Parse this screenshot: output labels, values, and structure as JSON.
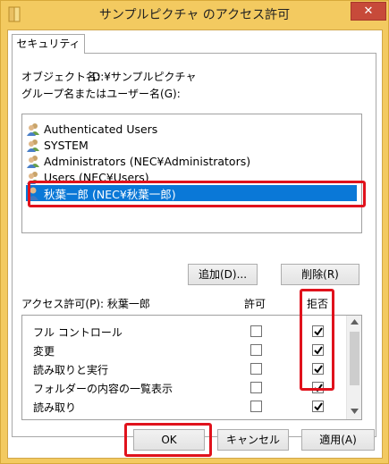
{
  "window": {
    "title": "サンプルピクチャ のアクセス許可",
    "close_glyph": "✕"
  },
  "tabs": [
    {
      "label": "セキュリティ"
    }
  ],
  "object": {
    "label": "オブジェクト名:",
    "value": "D:¥サンプルピクチャ"
  },
  "groups": {
    "label": "グループ名またはユーザー名(G):",
    "items": [
      {
        "name": "Authenticated Users",
        "icon": "users-group-icon"
      },
      {
        "name": "SYSTEM",
        "icon": "users-group-icon"
      },
      {
        "name": "Administrators (NEC¥Administrators)",
        "icon": "users-group-icon"
      },
      {
        "name": "Users (NEC¥Users)",
        "icon": "users-group-icon"
      },
      {
        "name": "秋葉一郎 (NEC¥秋葉一郎)",
        "icon": "user-icon",
        "selected": true
      }
    ]
  },
  "buttons": {
    "add": "追加(D)...",
    "remove": "削除(R)",
    "ok": "OK",
    "cancel": "キャンセル",
    "apply": "適用(A)"
  },
  "permissions": {
    "label": "アクセス許可(P): 秋葉一郎",
    "allow_header": "許可",
    "deny_header": "拒否",
    "rows": [
      {
        "name": "フル コントロール",
        "allow": false,
        "deny": true
      },
      {
        "name": "変更",
        "allow": false,
        "deny": true
      },
      {
        "name": "読み取りと実行",
        "allow": false,
        "deny": true
      },
      {
        "name": "フォルダーの内容の一覧表示",
        "allow": false,
        "deny": true
      },
      {
        "name": "読み取り",
        "allow": false,
        "deny": true
      }
    ]
  },
  "colors": {
    "title_bar": "#f3ca60",
    "selection": "#0a78d7",
    "highlight": "#e0121c",
    "close_button": "#c74a3a"
  }
}
